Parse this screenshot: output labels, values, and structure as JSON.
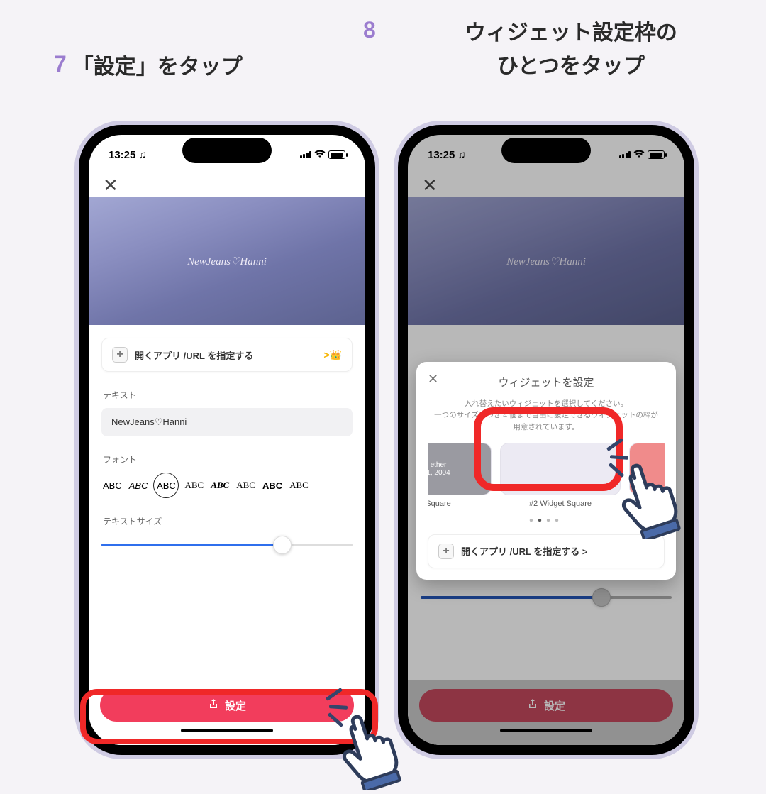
{
  "steps": {
    "left": {
      "num": "7",
      "text": "「設定」をタップ"
    },
    "right": {
      "num": "8",
      "text": "ウィジェット設定枠の\nひとつをタップ"
    }
  },
  "status": {
    "time": "13:25"
  },
  "hero_text": "NewJeans♡Hanni",
  "open_app_row": {
    "label": "開くアプリ /URL を指定する",
    "chevron": ">"
  },
  "sections": {
    "text_label": "テキスト",
    "text_value": "NewJeans♡Hanni",
    "font_label": "フォント",
    "size_label": "テキストサイズ"
  },
  "fonts": [
    "ABC",
    "ABC",
    "ABC",
    "ABC",
    "ABC",
    "ABC",
    "ABC",
    "ABC"
  ],
  "slider": {
    "fill_pct": 72
  },
  "settings_button": "設定",
  "modal": {
    "title": "ウィジェットを設定",
    "desc": "入れ替えたいウィジェットを選択してください。\n一つのサイズにつき 4 個まで自由に設定できるウィジェットの枠が用意されています。",
    "left_widget_line1": "ether",
    "left_widget_line2": "1, 2004",
    "left_label": "Square",
    "center_label": "#2 Widget Square",
    "open_app_row": "開くアプリ /URL を指定する >"
  }
}
